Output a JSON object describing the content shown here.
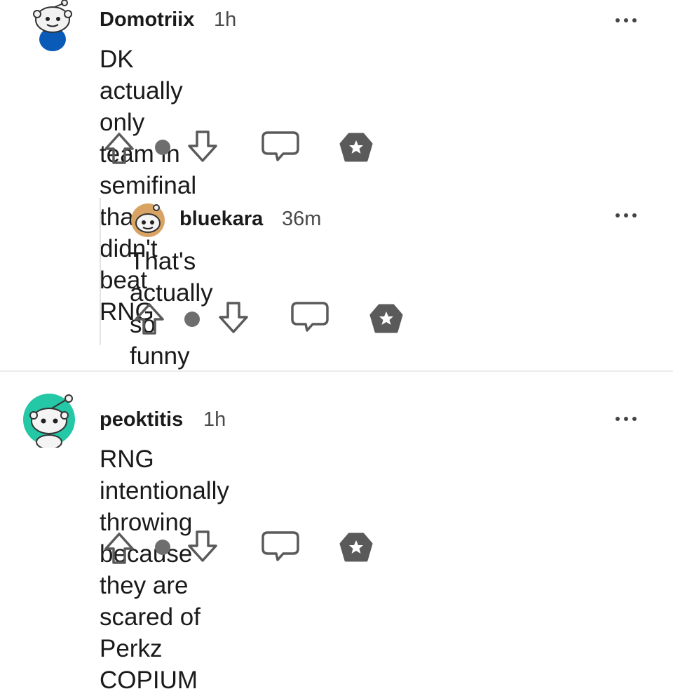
{
  "comments": [
    {
      "author": "Domotriix",
      "age": "1h",
      "body_line1": "DK actually only team in semifinal that didn't",
      "body_line2": "beat RNG",
      "avatar_color": "#f0f0f0",
      "avatar_shirt": "#0a5bb8"
    },
    {
      "author": "bluekara",
      "age": "36m",
      "body_line1": "That's actually so funny",
      "avatar_color": "#d9a463"
    },
    {
      "author": "peoktitis",
      "age": "1h",
      "body_line1": "RNG intentionally throwing because they are",
      "body_line2": "scared of Perkz COPIUM",
      "avatar_color": "#24c7a6"
    }
  ],
  "icons": {
    "upvote": "arrow-up-icon",
    "downvote": "arrow-down-icon",
    "reply": "speech-bubble-icon",
    "award": "star-badge-icon",
    "more": "ellipsis-icon"
  }
}
